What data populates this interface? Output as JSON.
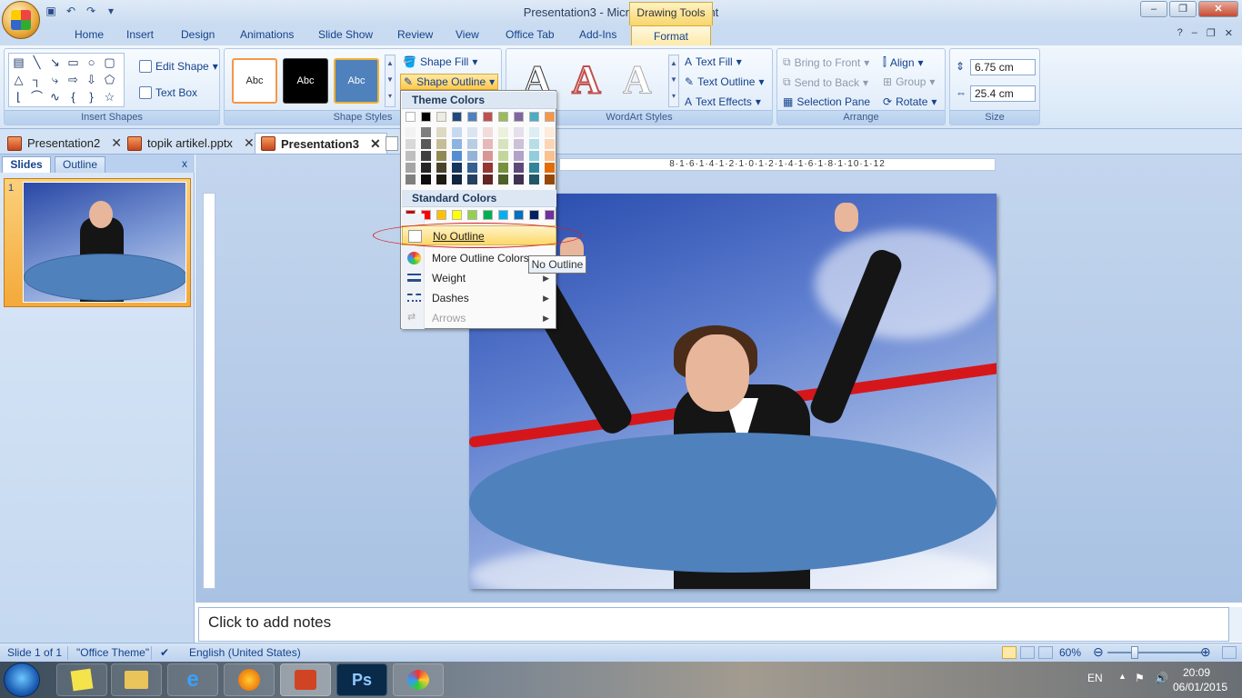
{
  "window": {
    "title": "Presentation3 - Microsoft PowerPoint",
    "context_tab": "Drawing Tools"
  },
  "tabs": [
    "Home",
    "Insert",
    "Design",
    "Animations",
    "Slide Show",
    "Review",
    "View",
    "Office Tab",
    "Add-Ins",
    "Format"
  ],
  "ribbon": {
    "insert_shapes": {
      "label": "Insert Shapes",
      "edit_shape": "Edit Shape",
      "text_box": "Text Box"
    },
    "shape_styles": {
      "label": "Shape Styles",
      "swatch_text": "Abc",
      "shape_fill": "Shape Fill",
      "shape_outline": "Shape Outline"
    },
    "wordart": {
      "label": "WordArt Styles",
      "text_fill": "Text Fill",
      "text_outline": "Text Outline",
      "text_effects": "Text Effects"
    },
    "arrange": {
      "label": "Arrange",
      "bring_to_front": "Bring to Front",
      "send_to_back": "Send to Back",
      "selection_pane": "Selection Pane",
      "align": "Align",
      "group": "Group",
      "rotate": "Rotate"
    },
    "size": {
      "label": "Size",
      "height": "6.75 cm",
      "width": "25.4 cm"
    }
  },
  "doc_tabs": [
    {
      "name": "Presentation2"
    },
    {
      "name": "topik artikel.pptx"
    },
    {
      "name": "Presentation3"
    }
  ],
  "left_pane": {
    "tab_slides": "Slides",
    "tab_outline": "Outline",
    "close": "x",
    "slide_number": "1"
  },
  "ruler_text": "8·1·6·1·4·1·2·1·0·1·2·1·4·1·6·1·8·1·10·1·12",
  "notes_placeholder": "Click to add notes",
  "status": {
    "slide": "Slide 1 of 1",
    "theme": "\"Office Theme\"",
    "language": "English (United States)",
    "zoom": "60%"
  },
  "dropdown": {
    "theme_colors": "Theme Colors",
    "standard_colors": "Standard Colors",
    "theme_row": [
      "#ffffff",
      "#000000",
      "#eeece1",
      "#1f497d",
      "#4f81bd",
      "#c0504d",
      "#9bbb59",
      "#8064a2",
      "#4bacc6",
      "#f79646"
    ],
    "shade_columns": [
      [
        "#f2f2f2",
        "#d8d8d8",
        "#bfbfbf",
        "#a5a5a5",
        "#7f7f7f"
      ],
      [
        "#7f7f7f",
        "#595959",
        "#3f3f3f",
        "#262626",
        "#0c0c0c"
      ],
      [
        "#ddd9c3",
        "#c4bd97",
        "#938953",
        "#494429",
        "#1d1b10"
      ],
      [
        "#c6d9f0",
        "#8db3e2",
        "#548dd4",
        "#17365d",
        "#0f243e"
      ],
      [
        "#dbe5f1",
        "#b8cce4",
        "#95b3d7",
        "#366092",
        "#244061"
      ],
      [
        "#f2dcdb",
        "#e5b9b7",
        "#d99694",
        "#953734",
        "#632423"
      ],
      [
        "#ebf1dd",
        "#d7e3bc",
        "#c3d69b",
        "#76923c",
        "#4f6128"
      ],
      [
        "#e5e0ec",
        "#ccc1d9",
        "#b2a2c7",
        "#5f497a",
        "#3f3151"
      ],
      [
        "#dbeef3",
        "#b7dde8",
        "#92cddc",
        "#31859b",
        "#205867"
      ],
      [
        "#fdeada",
        "#fbd5b5",
        "#fac08f",
        "#e36c09",
        "#974806"
      ]
    ],
    "standard_row": [
      "#c00000",
      "#ff0000",
      "#ffc000",
      "#ffff00",
      "#92d050",
      "#00b050",
      "#00b0f0",
      "#0070c0",
      "#002060",
      "#7030a0"
    ],
    "no_outline": "No Outline",
    "more_colors": "More Outline Colors...",
    "weight": "Weight",
    "dashes": "Dashes",
    "arrows": "Arrows",
    "tooltip": "No Outline"
  },
  "taskbar": {
    "lang": "EN",
    "time": "20:09",
    "date": "06/01/2015"
  }
}
